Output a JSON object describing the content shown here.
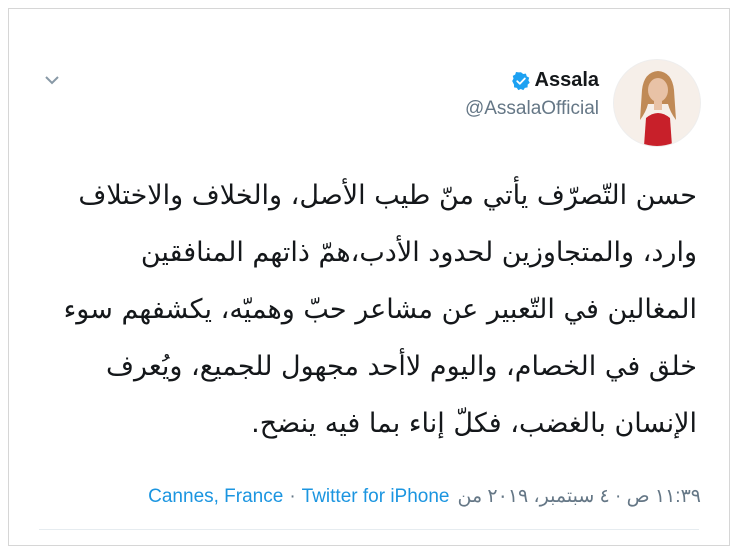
{
  "author": {
    "display_name": "Assala",
    "handle": "@AssalaOfficial",
    "verified": true
  },
  "tweet": {
    "text": "حسن التّصرّف يأتي منّ طيب الأصل، والخلاف والاختلاف وارد، والمتجاوزين لحدود الأدب،همّ ذاتهم المنافقين المغالين في التّعبير عن مشاعر حبّ وهميّه، يكشفهم سوء خلق في الخصام، واليوم لاأحد مجهول للجميع، ويُعرف الإنسان بالغضب، فكلّ إناء بما فيه ينضح."
  },
  "meta": {
    "timestamp": "١١:٣٩ ص · ٤ سبتمبر، ٢٠١٩ من",
    "source": "Twitter for iPhone",
    "separator": "·",
    "location": "Cannes, France"
  },
  "colors": {
    "link": "#1b95e0",
    "muted": "#657786",
    "text": "#14171a",
    "verified_badge": "#1da1f2"
  },
  "icons": {
    "menu": "chevron-down-icon",
    "verified": "verified-badge-icon"
  }
}
